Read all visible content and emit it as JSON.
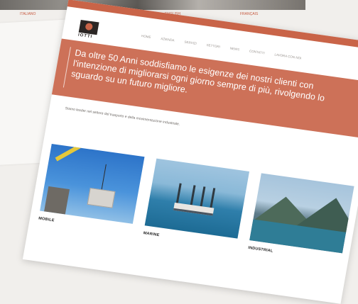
{
  "background": {
    "captions": [
      "ITALIANO",
      "ENGLISH",
      "FRANÇAIS"
    ]
  },
  "logo": {
    "text": "IOTTI"
  },
  "nav": {
    "items": [
      "HOME",
      "AZIENDA",
      "SERVIZI",
      "SETTORI",
      "NEWS",
      "CONTATTI",
      "LAVORA CON NOI"
    ]
  },
  "hero": {
    "line1": "Da oltre 50 Anni soddisfiamo le esigenze dei nostri clienti con",
    "line2": "l'intenzione di migliorarsi ogni giorno sempre di più, rivolgendo lo",
    "line3": "sguardo su un futuro migliore."
  },
  "intro": {
    "lead": "Siamo leader nel settore del trasporto e della movimentazione industriale."
  },
  "sectors": [
    {
      "label": "MOBILE"
    },
    {
      "label": "MARINE"
    },
    {
      "label": "INDUSTRIAL"
    }
  ],
  "colors": {
    "accent": "#c96448",
    "hero": "#cd7158",
    "background": "#f1efec"
  }
}
